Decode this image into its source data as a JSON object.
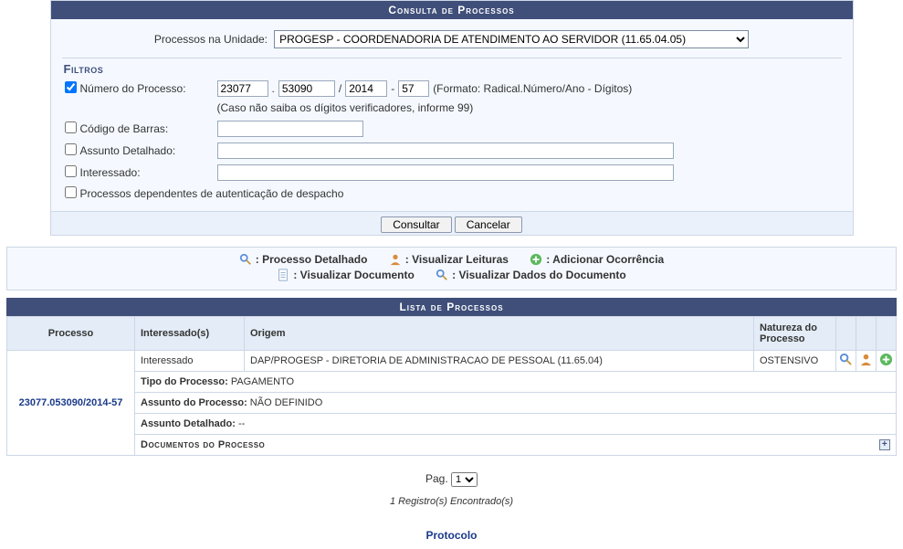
{
  "panel": {
    "title": "Consulta de Processos",
    "unit_label": "Processos na Unidade:",
    "unit_value": "PROGESP - COORDENADORIA DE ATENDIMENTO AO SERVIDOR (11.65.04.05)",
    "filtros_hdr": "Filtros",
    "filters": {
      "numero_label": "Número do Processo:",
      "numero_checked": true,
      "radical": "23077",
      "numero": "53090",
      "ano": "2014",
      "digitos": "57",
      "sep_dot": ".",
      "sep_slash": "/",
      "sep_dash": "-",
      "formato_hint": "(Formato: Radical.Número/Ano - Dígitos)",
      "verif_hint": "(Caso não saiba os dígitos verificadores, informe 99)",
      "barras_label": "Código de Barras:",
      "barras_value": "",
      "assunto_label": "Assunto Detalhado:",
      "assunto_value": "",
      "interessado_label": "Interessado:",
      "interessado_value": "",
      "dependentes_label": "Processos dependentes de autenticação de despacho"
    },
    "buttons": {
      "consultar": "Consultar",
      "cancelar": "Cancelar"
    }
  },
  "legend": {
    "zoom": ": Processo Detalhado",
    "leituras": ": Visualizar Leituras",
    "add": ": Adicionar Ocorrência",
    "doc": ": Visualizar Documento",
    "docdata": ": Visualizar Dados do Documento"
  },
  "list": {
    "title": "Lista de Processos",
    "headers": {
      "processo": "Processo",
      "interessados": "Interessado(s)",
      "origem": "Origem",
      "natureza": "Natureza do Processo"
    },
    "row": {
      "processo_link": "23077.053090/2014-57",
      "interessado": "Interessado",
      "origem": "DAP/PROGESP - DIRETORIA DE ADMINISTRACAO DE PESSOAL (11.65.04)",
      "natureza": "OSTENSIVO",
      "tipo_label": "Tipo do Processo:",
      "tipo_val": " PAGAMENTO",
      "assunto_proc_label": "Assunto do Processo:",
      "assunto_proc_val": " NÃO DEFINIDO",
      "assunto_det_label": "Assunto Detalhado:",
      "assunto_det_val": " --",
      "docs_hdr": "Documentos do Processo"
    }
  },
  "pager": {
    "label": "Pag. ",
    "value": "1"
  },
  "records": "1 Registro(s) Encontrado(s)",
  "footer": "Protocolo"
}
